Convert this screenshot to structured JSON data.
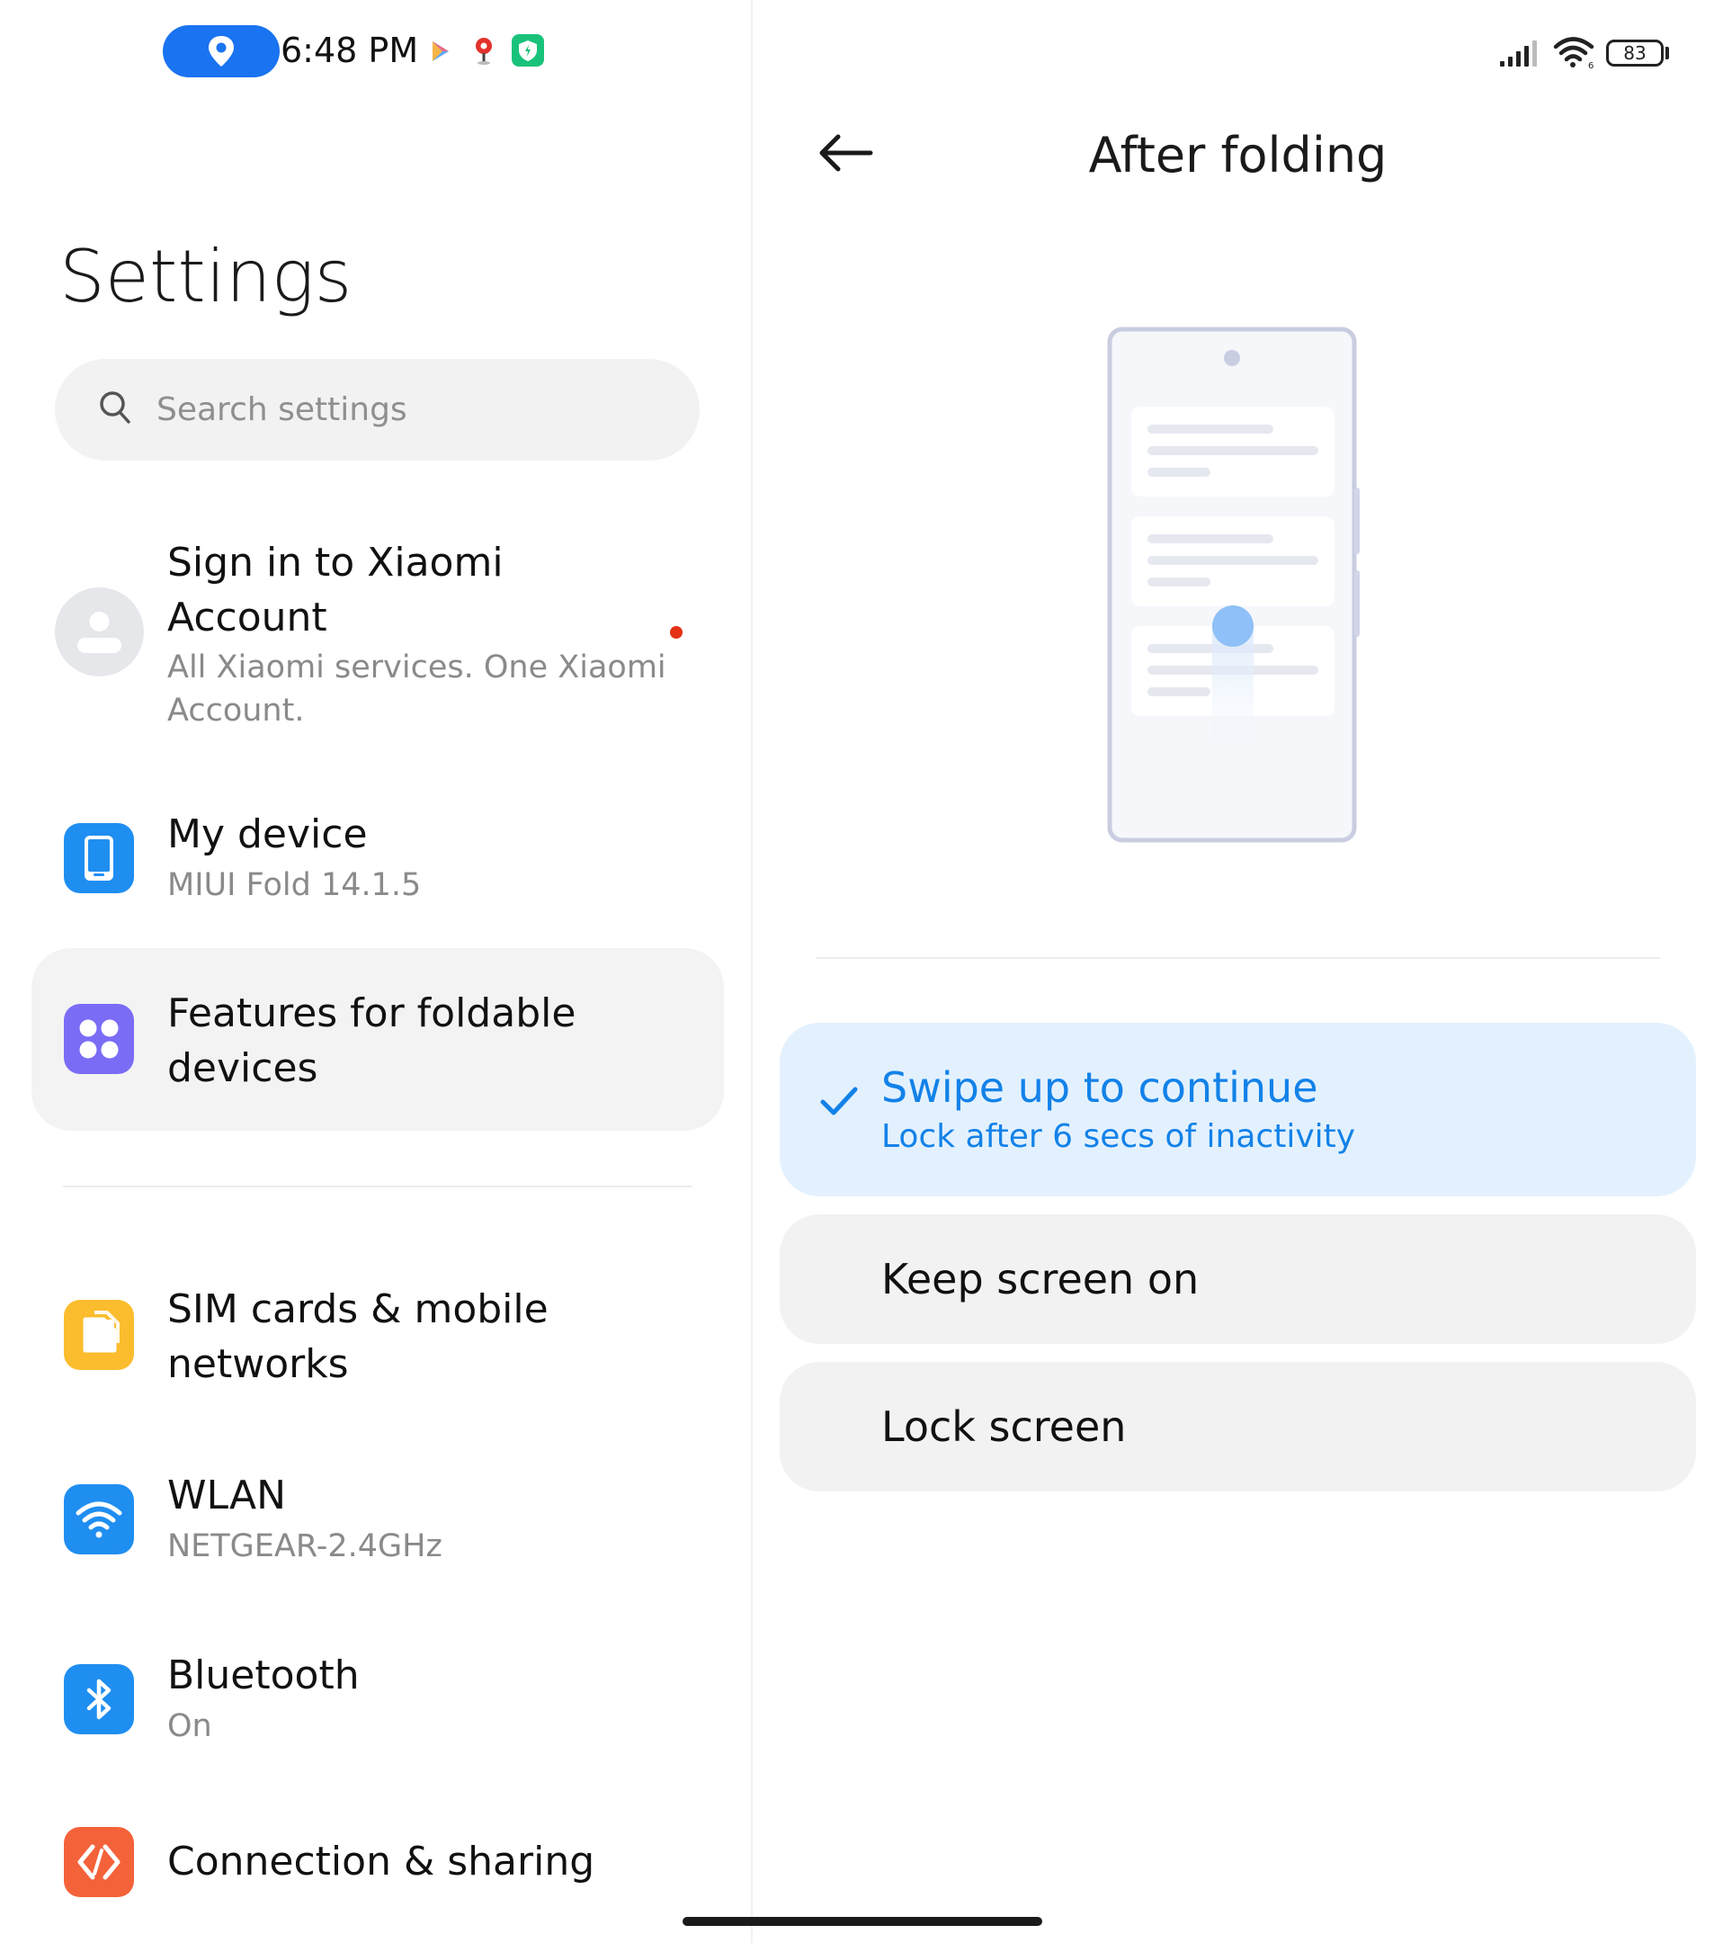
{
  "status_bar": {
    "time": "6:48 PM",
    "battery": "83",
    "icons": [
      "location-icon",
      "play-store-icon",
      "map-pin-icon",
      "security-shield-icon",
      "signal-icon",
      "wifi-icon",
      "battery-icon"
    ]
  },
  "left": {
    "title": "Settings",
    "search": {
      "placeholder": "Search settings"
    },
    "account": {
      "title_line1": "Sign in to Xiaomi",
      "title_line2": "Account",
      "subtitle_line1": "All Xiaomi services. One Xiaomi",
      "subtitle_line2": "Account."
    },
    "items": [
      {
        "title": "My device",
        "subtitle": "MIUI Fold 14.1.5",
        "icon": "phone-icon",
        "color": "#1f8ef1"
      },
      {
        "title_line1": "Features for foldable",
        "title_line2": "devices",
        "icon": "grid-icon",
        "color": "#7b6cf6"
      },
      {
        "title_line1": "SIM cards & mobile",
        "title_line2": "networks",
        "icon": "sim-icon",
        "color": "#fbbd2e"
      },
      {
        "title": "WLAN",
        "subtitle": "NETGEAR-2.4GHz",
        "icon": "wifi-icon",
        "color": "#1f8ef1"
      },
      {
        "title": "Bluetooth",
        "subtitle": "On",
        "icon": "bluetooth-icon",
        "color": "#1f8ef1"
      },
      {
        "title": "Connection & sharing",
        "icon": "share-icon",
        "color": "#f4623a"
      }
    ]
  },
  "right": {
    "title": "After folding",
    "options": [
      {
        "title": "Swipe up to continue",
        "subtitle": "Lock after 6 secs of inactivity",
        "selected": true
      },
      {
        "title": "Keep screen on",
        "selected": false
      },
      {
        "title": "Lock screen",
        "selected": false
      }
    ]
  },
  "colors": {
    "accent": "#1382e8",
    "selected_bg": "#e3f1ff"
  }
}
